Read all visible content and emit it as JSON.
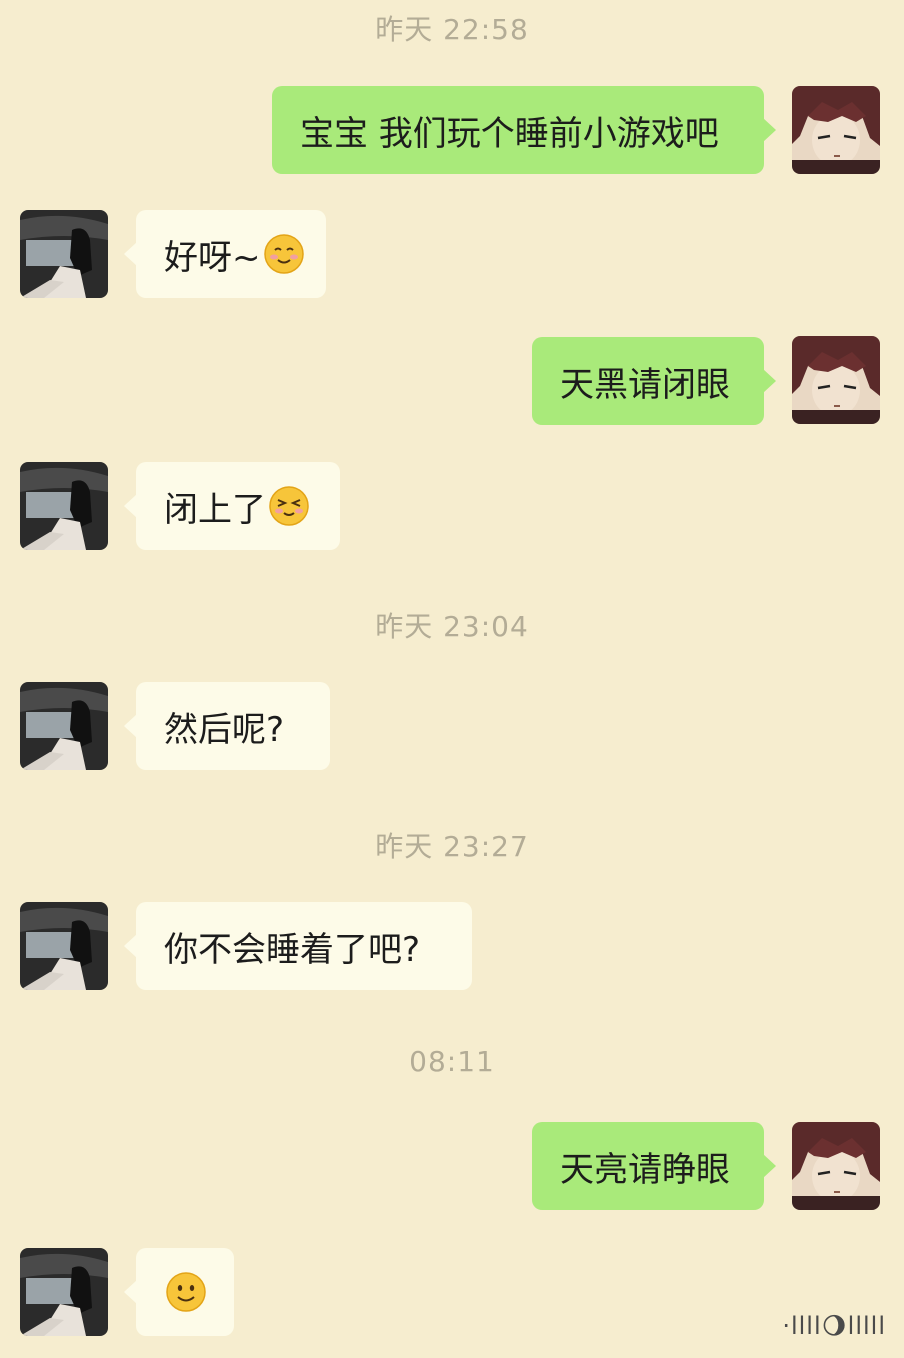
{
  "timestamps": [
    "昨天 22:58",
    "昨天 23:04",
    "昨天 23:27",
    "08:11"
  ],
  "messages": [
    {
      "side": "out",
      "text": "宝宝 我们玩个睡前小游戏吧"
    },
    {
      "side": "in",
      "text": "好呀~",
      "emoji": "smiling-face-emoji"
    },
    {
      "side": "out",
      "text": "天黑请闭眼"
    },
    {
      "side": "in",
      "text": "闭上了",
      "emoji": "closed-eyes-face-emoji"
    },
    {
      "side": "in",
      "text": "然后呢?"
    },
    {
      "side": "in",
      "text": "你不会睡着了吧?"
    },
    {
      "side": "out",
      "text": "天亮请睁眼"
    },
    {
      "side": "in",
      "text": "",
      "emoji": "smile-face-emoji"
    }
  ],
  "watermark": "·llll🌖lllll"
}
